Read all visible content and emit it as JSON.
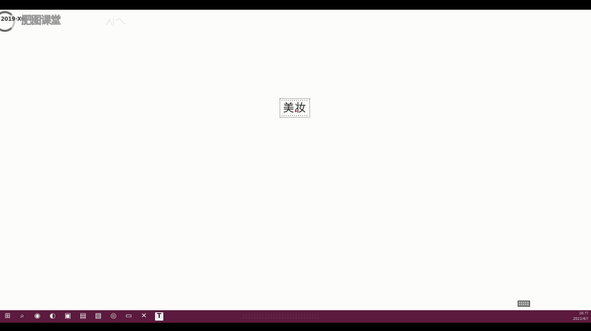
{
  "watermark": {
    "year": "2019·X0",
    "name": "肥图课堂"
  },
  "center_logo": {
    "text": "美妆"
  },
  "taskbar": {
    "icons": [
      {
        "name": "windows-start-icon",
        "glyph": "⊞"
      },
      {
        "name": "search-icon",
        "glyph": "⌕"
      },
      {
        "name": "browser-icon",
        "glyph": "◉"
      },
      {
        "name": "app-icon",
        "glyph": "◐"
      },
      {
        "name": "files-icon",
        "glyph": "▣"
      },
      {
        "name": "document-icon",
        "glyph": "▤"
      },
      {
        "name": "image-icon",
        "glyph": "▧"
      },
      {
        "name": "game-icon",
        "glyph": "◎"
      },
      {
        "name": "folder-icon",
        "glyph": "▭"
      },
      {
        "name": "tool-icon",
        "glyph": "✕"
      },
      {
        "name": "text-icon",
        "glyph": "T"
      }
    ],
    "clock_time": "16:??",
    "clock_date": "2021/4/?"
  },
  "colors": {
    "taskbar": "#5b1a3e",
    "desktop": "#fcfcfb",
    "accent": "#b3385a"
  }
}
